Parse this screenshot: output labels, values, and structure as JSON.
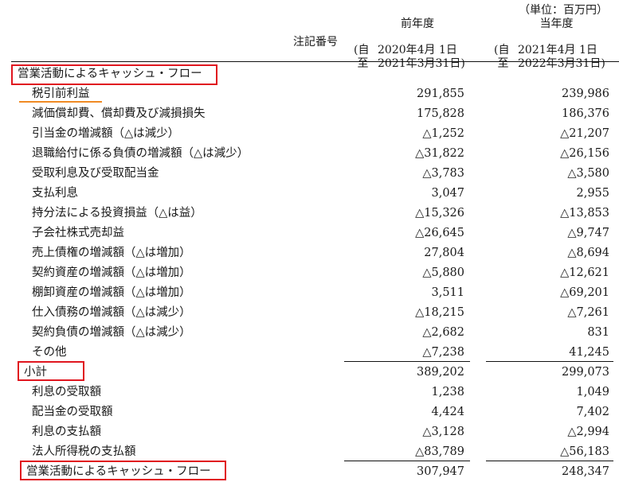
{
  "unit_label": "（単位：百万円）",
  "header": {
    "note_label": "注記番号",
    "prior": {
      "title": "前年度",
      "open": "(自",
      "close": "至",
      "from": "2020年4月 1日",
      "to": "2021年3月31日)"
    },
    "current": {
      "title": "当年度",
      "open": "(自",
      "close": "至",
      "from": "2021年4月 1日",
      "to": "2022年3月31日)"
    }
  },
  "section_title": "営業活動によるキャッシュ・フロー",
  "rows": [
    {
      "label": "税引前利益",
      "prior": "291,855",
      "current": "239,986"
    },
    {
      "label": "減価償却費、償却費及び減損損失",
      "prior": "175,828",
      "current": "186,376"
    },
    {
      "label": "引当金の増減額（△は減少）",
      "prior": "△1,252",
      "current": "△21,207"
    },
    {
      "label": "退職給付に係る負債の増減額（△は減少）",
      "prior": "△31,822",
      "current": "△26,156"
    },
    {
      "label": "受取利息及び受取配当金",
      "prior": "△3,783",
      "current": "△3,580"
    },
    {
      "label": "支払利息",
      "prior": "3,047",
      "current": "2,955"
    },
    {
      "label": "持分法による投資損益（△は益）",
      "prior": "△15,326",
      "current": "△13,853"
    },
    {
      "label": "子会社株式売却益",
      "prior": "△26,645",
      "current": "△9,747"
    },
    {
      "label": "売上債権の増減額（△は増加）",
      "prior": "27,804",
      "current": "△8,694"
    },
    {
      "label": "契約資産の増減額（△は増加）",
      "prior": "△5,880",
      "current": "△12,621"
    },
    {
      "label": "棚卸資産の増減額（△は増加）",
      "prior": "3,511",
      "current": "△69,201"
    },
    {
      "label": "仕入債務の増減額（△は減少）",
      "prior": "△18,215",
      "current": "△7,261"
    },
    {
      "label": "契約負債の増減額（△は減少）",
      "prior": "△2,682",
      "current": "831"
    },
    {
      "label": "その他",
      "prior": "△7,238",
      "current": "41,245"
    },
    {
      "label": "小計",
      "prior": "389,202",
      "current": "299,073"
    },
    {
      "label": "利息の受取額",
      "prior": "1,238",
      "current": "1,049"
    },
    {
      "label": "配当金の受取額",
      "prior": "4,424",
      "current": "7,402"
    },
    {
      "label": "利息の支払額",
      "prior": "△3,128",
      "current": "△2,994"
    },
    {
      "label": "法人所得税の支払額",
      "prior": "△83,789",
      "current": "△56,183"
    },
    {
      "label": "営業活動によるキャッシュ・フロー",
      "prior": "307,947",
      "current": "248,347"
    }
  ],
  "highlight_colors": {
    "box": "#e0161f",
    "underline": "#f08a24"
  }
}
